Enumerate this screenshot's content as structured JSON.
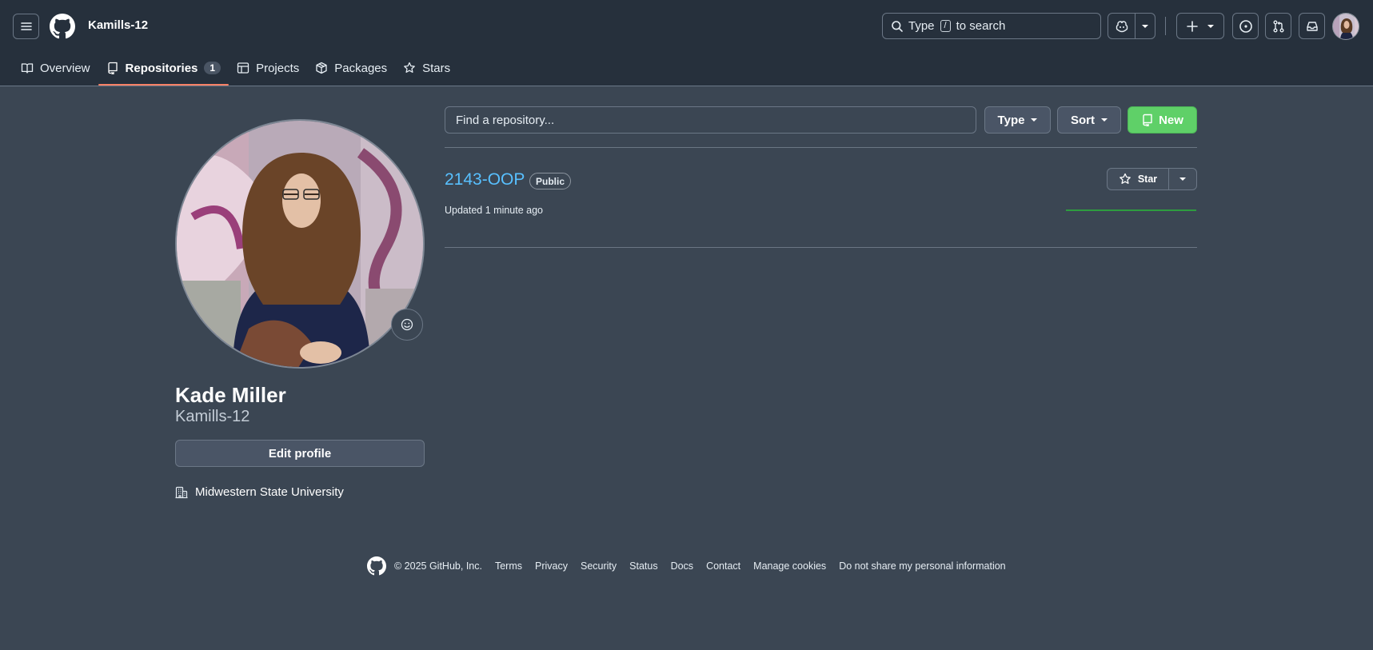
{
  "header": {
    "username": "Kamills-12",
    "search": {
      "prefix": "Type",
      "key": "/",
      "suffix": "to search"
    }
  },
  "tabs": [
    {
      "label": "Overview",
      "icon": "book-icon",
      "active": false
    },
    {
      "label": "Repositories",
      "icon": "repo-icon",
      "active": true,
      "count": "1"
    },
    {
      "label": "Projects",
      "icon": "table-icon",
      "active": false
    },
    {
      "label": "Packages",
      "icon": "package-icon",
      "active": false
    },
    {
      "label": "Stars",
      "icon": "star-icon",
      "active": false
    }
  ],
  "profile": {
    "full_name": "Kade Miller",
    "login": "Kamills-12",
    "edit_label": "Edit profile",
    "organization": "Midwestern State University"
  },
  "toolbar": {
    "search_placeholder": "Find a repository...",
    "type_label": "Type",
    "sort_label": "Sort",
    "new_label": "New"
  },
  "repos": [
    {
      "name": "2143-OOP",
      "visibility": "Public",
      "updated": "Updated 1 minute ago",
      "star_label": "Star"
    }
  ],
  "footer": {
    "copyright": "© 2025 GitHub, Inc.",
    "links": [
      "Terms",
      "Privacy",
      "Security",
      "Status",
      "Docs",
      "Contact",
      "Manage cookies",
      "Do not share my personal information"
    ]
  },
  "colors": {
    "header_bg": "#26303c",
    "page_bg": "#3b4653",
    "link_blue": "#58c0ff",
    "new_button_green": "#5fd068",
    "active_tab_underline": "#f78166",
    "activity_green": "#2e9c3f"
  }
}
